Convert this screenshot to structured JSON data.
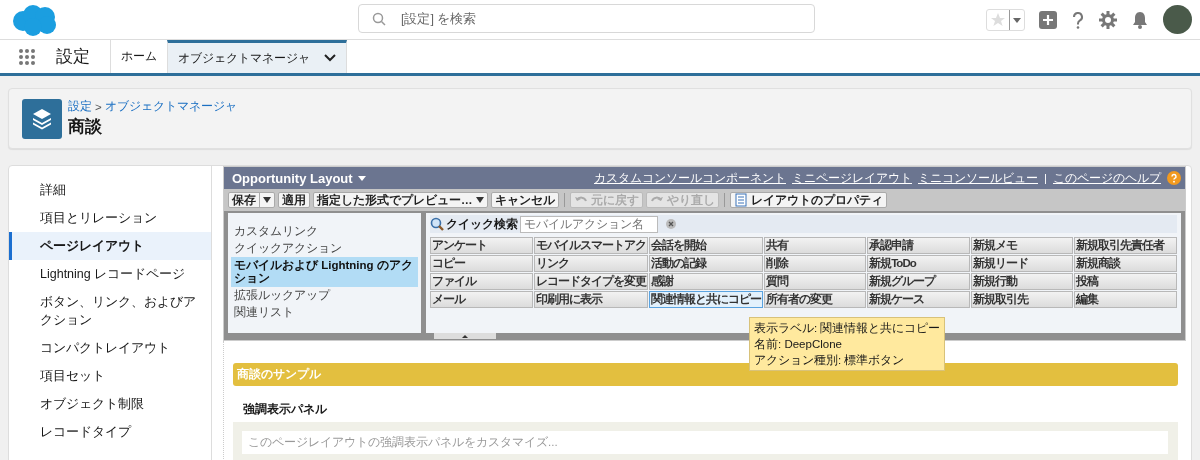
{
  "header": {
    "search": {
      "placeholder": "[設定] を検索"
    }
  },
  "nav": {
    "app_name": "設定",
    "tabs": [
      {
        "label": "ホーム",
        "selected": false,
        "has_menu": false
      },
      {
        "label": "オブジェクトマネージャ",
        "selected": true,
        "has_menu": true
      }
    ]
  },
  "page_header": {
    "breadcrumb": [
      "設定",
      "オブジェクトマネージャ"
    ],
    "separator": ">",
    "title": "商談"
  },
  "sidebar": {
    "items": [
      {
        "label": "詳細",
        "selected": false
      },
      {
        "label": "項目とリレーション",
        "selected": false
      },
      {
        "label": "ページレイアウト",
        "selected": true
      },
      {
        "label": "Lightning レコードページ",
        "selected": false
      },
      {
        "label": "ボタン、リンク、およびアクション",
        "selected": false
      },
      {
        "label": "コンパクトレイアウト",
        "selected": false
      },
      {
        "label": "項目セット",
        "selected": false
      },
      {
        "label": "オブジェクト制限",
        "selected": false
      },
      {
        "label": "レコードタイプ",
        "selected": false
      }
    ]
  },
  "layout_editor": {
    "title": "Opportunity Layout",
    "links": [
      "カスタムコンソールコンポーネント",
      "ミニページレイアウト",
      "ミニコンソールビュー",
      "このページのヘルプ"
    ],
    "link_separator": "|",
    "toolbar": [
      {
        "label": "保存",
        "kind": "split",
        "disabled": false
      },
      {
        "label": "適用",
        "kind": "plain",
        "disabled": false
      },
      {
        "label": "指定した形式でプレビュー…",
        "kind": "menu",
        "disabled": false
      },
      {
        "label": "キャンセル",
        "kind": "plain",
        "disabled": false
      },
      {
        "label": "元に戻す",
        "kind": "undo",
        "disabled": true
      },
      {
        "label": "やり直し",
        "kind": "redo",
        "disabled": true
      },
      {
        "label": "レイアウトのプロパティ",
        "kind": "properties",
        "disabled": false
      }
    ],
    "categories": [
      {
        "label": "カスタムリンク",
        "selected": false
      },
      {
        "label": "クイックアクション",
        "selected": false
      },
      {
        "label": "モバイルおよび Lightning のアクション",
        "selected": true
      },
      {
        "label": "拡張ルックアップ",
        "selected": false
      },
      {
        "label": "関連リスト",
        "selected": false
      }
    ],
    "quick_search": {
      "label": "クイック検索",
      "placeholder": "モバイルアクション名"
    },
    "actions": [
      {
        "label": "アンケート",
        "selected": false
      },
      {
        "label": "モバイルスマートアク",
        "selected": false
      },
      {
        "label": "会話を開始",
        "selected": false
      },
      {
        "label": "共有",
        "selected": false
      },
      {
        "label": "承認申請",
        "selected": false
      },
      {
        "label": "新規メモ",
        "selected": false
      },
      {
        "label": "新規取引先責任者",
        "selected": false
      },
      {
        "label": "コピー",
        "selected": false
      },
      {
        "label": "リンク",
        "selected": false
      },
      {
        "label": "活動の記録",
        "selected": false
      },
      {
        "label": "削除",
        "selected": false
      },
      {
        "label": "新規ToDo",
        "selected": false
      },
      {
        "label": "新規リード",
        "selected": false
      },
      {
        "label": "新規商談",
        "selected": false
      },
      {
        "label": "ファイル",
        "selected": false
      },
      {
        "label": "レコードタイプを変更",
        "selected": false
      },
      {
        "label": "感謝",
        "selected": false
      },
      {
        "label": "質問",
        "selected": false
      },
      {
        "label": "新規グループ",
        "selected": false
      },
      {
        "label": "新規行動",
        "selected": false
      },
      {
        "label": "投稿",
        "selected": false
      },
      {
        "label": "メール",
        "selected": false
      },
      {
        "label": "印刷用に表示",
        "selected": false
      },
      {
        "label": "関連情報と共にコピー",
        "selected": true
      },
      {
        "label": "所有者の変更",
        "selected": false
      },
      {
        "label": "新規ケース",
        "selected": false
      },
      {
        "label": "新規取引先",
        "selected": false
      },
      {
        "label": "編集",
        "selected": false
      }
    ],
    "tooltip": {
      "lines": [
        "表示ラベル: 関連情報と共にコピー",
        "名前: DeepClone",
        "アクション種別: 標準ボタン"
      ]
    }
  },
  "preview": {
    "section_title": "商談のサンプル",
    "panel_title": "強調表示パネル",
    "panel_placeholder": "このページレイアウトの強調表示パネルをカスタマイズ..."
  }
}
